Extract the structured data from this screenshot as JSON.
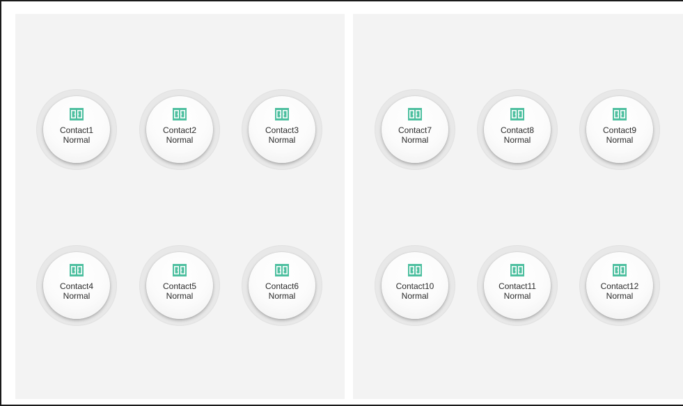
{
  "icon": "contact-door-icon",
  "colors": {
    "icon": "#4dbf9f",
    "panel": "#f3f3f3"
  },
  "panels": [
    {
      "contacts": [
        {
          "name": "Contact1",
          "status": "Normal"
        },
        {
          "name": "Contact2",
          "status": "Normal"
        },
        {
          "name": "Contact3",
          "status": "Normal"
        },
        {
          "name": "Contact4",
          "status": "Normal"
        },
        {
          "name": "Contact5",
          "status": "Normal"
        },
        {
          "name": "Contact6",
          "status": "Normal"
        }
      ]
    },
    {
      "contacts": [
        {
          "name": "Contact7",
          "status": "Normal"
        },
        {
          "name": "Contact8",
          "status": "Normal"
        },
        {
          "name": "Contact9",
          "status": "Normal"
        },
        {
          "name": "Contact10",
          "status": "Normal"
        },
        {
          "name": "Contact11",
          "status": "Normal"
        },
        {
          "name": "Contact12",
          "status": "Normal"
        }
      ]
    }
  ]
}
